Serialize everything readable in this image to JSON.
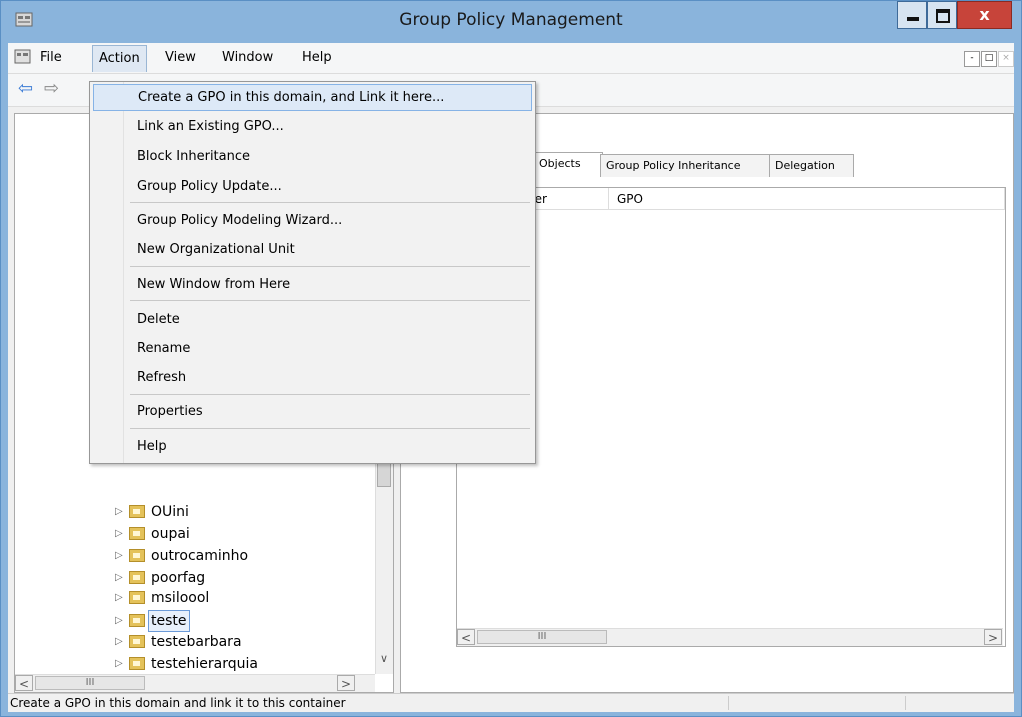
{
  "window": {
    "title": "Group Policy Management",
    "close_glyph": "x"
  },
  "menubar": {
    "items": [
      "File",
      "Action",
      "View",
      "Window",
      "Help"
    ],
    "mdi_controls": [
      "-",
      "□",
      "×"
    ]
  },
  "toolbar": {
    "back": "⇦",
    "forward": "⇨"
  },
  "action_menu": {
    "items": [
      "Create a GPO in this domain, and Link it here...",
      "Link an Existing GPO...",
      "Block Inheritance",
      "Group Policy Update...",
      "Group Policy Modeling Wizard...",
      "New Organizational Unit",
      "New Window from Here",
      "Delete",
      "Rename",
      "Refresh",
      "Properties",
      "Help"
    ],
    "highlighted": "Create a GPO in this domain, and Link it here..."
  },
  "tree": {
    "items": [
      "OUini",
      "oupai",
      "outrocaminho",
      "poorfag",
      "msiloool",
      "teste",
      "testebarbara",
      "testehierarquia"
    ],
    "selected": "teste",
    "expander": "▷"
  },
  "tabs": [
    "Objects",
    "Group Policy Inheritance",
    "Delegation"
  ],
  "listview": {
    "columns": [
      "der",
      "GPO"
    ]
  },
  "scroll": {
    "left": "<",
    "right": ">",
    "down": "∨",
    "grip": "III"
  },
  "statusbar": {
    "text": "Create a GPO in this domain and link it to this container"
  }
}
